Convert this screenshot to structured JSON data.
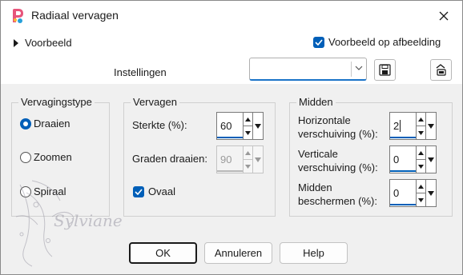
{
  "window": {
    "title": "Radiaal vervagen"
  },
  "top": {
    "preview_toggle_label": "Voorbeeld",
    "preview_on_image_label": "Voorbeeld op afbeelding",
    "preview_on_image_checked": true,
    "settings_label": "Instellingen",
    "settings_value": ""
  },
  "blur_type": {
    "title": "Vervagingstype",
    "options": [
      {
        "label": "Draaien",
        "selected": true
      },
      {
        "label": "Zoomen",
        "selected": false
      },
      {
        "label": "Spiraal",
        "selected": false
      }
    ]
  },
  "blur": {
    "title": "Vervagen",
    "strength_label": "Sterkte (%):",
    "strength_value": "60",
    "twist_label": "Graden draaien:",
    "twist_value": "90",
    "ellipse_label": "Ovaal",
    "ellipse_checked": true
  },
  "center": {
    "title": "Midden",
    "h_offset_label_1": "Horizontale",
    "h_offset_label_2": "verschuiving (%):",
    "h_offset_value": "2",
    "v_offset_label_1": "Verticale",
    "v_offset_label_2": "verschuiving (%):",
    "v_offset_value": "0",
    "protect_label_1": "Midden",
    "protect_label_2": "beschermen (%):",
    "protect_value": "0"
  },
  "buttons": {
    "ok": "OK",
    "cancel": "Annuleren",
    "help": "Help"
  },
  "watermark_text": "Sylviane",
  "colors": {
    "accent": "#005fb8",
    "background": "#f0f0f0"
  }
}
